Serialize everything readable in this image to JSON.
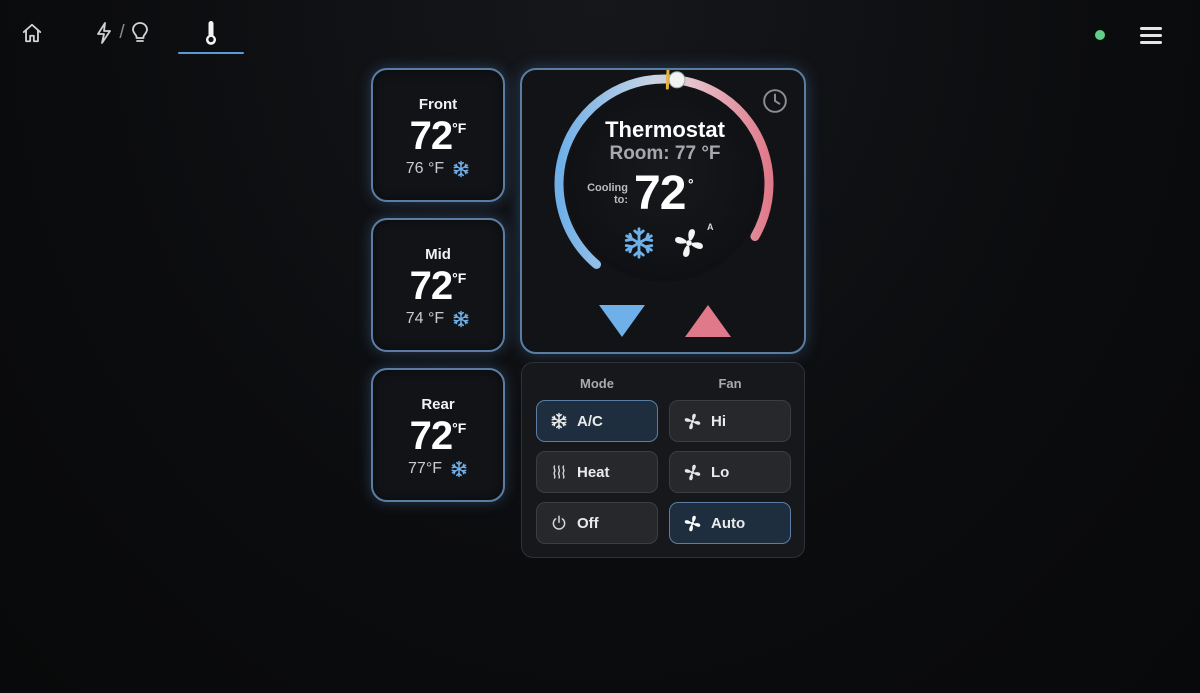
{
  "nav": {
    "items": [
      {
        "name": "home",
        "icon": "home-icon"
      },
      {
        "name": "power-lights",
        "icon": "bolt-icon",
        "separator": "/",
        "icon2": "lightbulb-icon"
      },
      {
        "name": "climate",
        "icon": "thermometer-icon",
        "active": true
      }
    ],
    "status_color": "#5fd08a",
    "menu_icon": "hamburger-menu-icon"
  },
  "zones": [
    {
      "name": "Front",
      "setpoint": "72",
      "unit": "°F",
      "current": "76 °F",
      "mode_icon": "snowflake-icon"
    },
    {
      "name": "Mid",
      "setpoint": "72",
      "unit": "°F",
      "current": "74 °F",
      "mode_icon": "snowflake-icon"
    },
    {
      "name": "Rear",
      "setpoint": "72",
      "unit": "°F",
      "current": "77°F",
      "mode_icon": "snowflake-icon"
    }
  ],
  "thermostat": {
    "title": "Thermostat",
    "room": "Room: 77 °F",
    "cooling_label": "Cooling to:",
    "setpoint": "72",
    "degree": "°",
    "fan_mode_badge": "A",
    "dial_fraction": 0.78,
    "colors": {
      "cool": "#6fb0e8",
      "heat": "#e07a8a",
      "marker": "#e5b43a"
    }
  },
  "controls": {
    "mode_header": "Mode",
    "fan_header": "Fan",
    "mode_buttons": [
      {
        "label": "A/C",
        "icon": "snowflake-icon",
        "active": true
      },
      {
        "label": "Heat",
        "icon": "heat-waves-icon",
        "active": false
      },
      {
        "label": "Off",
        "icon": "power-icon",
        "active": false
      }
    ],
    "fan_buttons": [
      {
        "label": "Hi",
        "icon": "fan-icon",
        "active": false
      },
      {
        "label": "Lo",
        "icon": "fan-icon",
        "active": false
      },
      {
        "label": "Auto",
        "icon": "fan-icon",
        "active": true
      }
    ]
  }
}
